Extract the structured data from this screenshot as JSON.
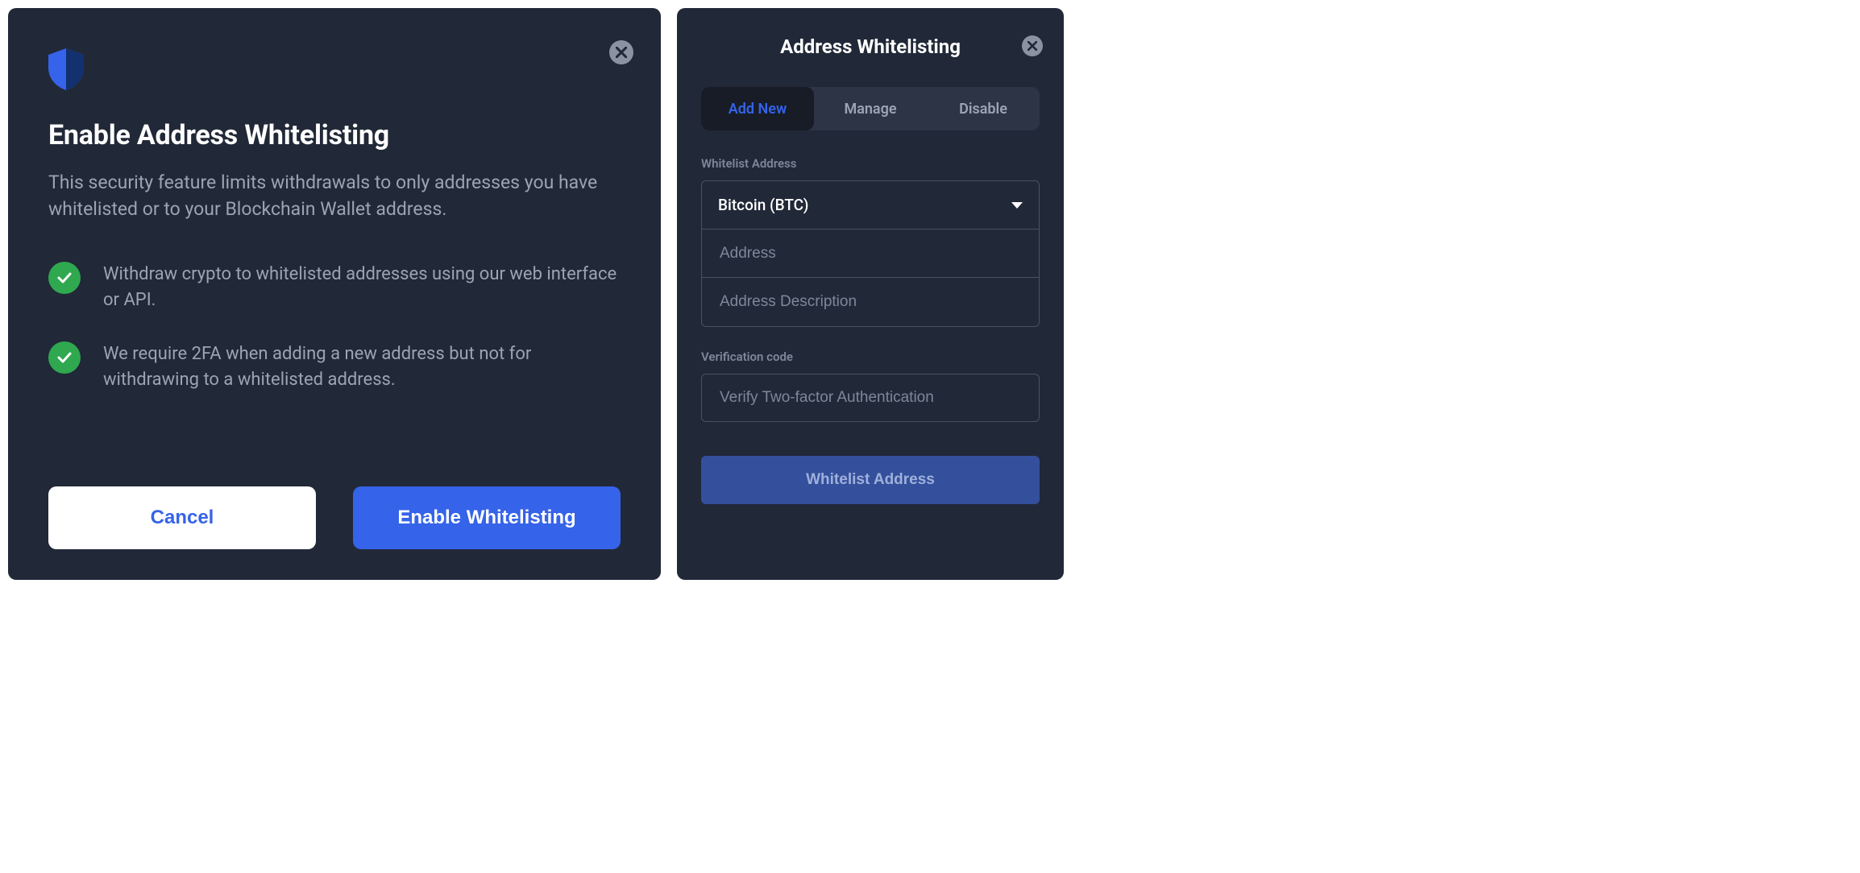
{
  "modal_enable": {
    "title": "Enable Address Whitelisting",
    "description": "This security feature limits withdrawals to only addresses you have whitelisted or to your Blockchain Wallet address.",
    "bullets": [
      "Withdraw crypto to whitelisted addresses using our web interface or API.",
      "We require 2FA when adding a new address but not for withdrawing to a whitelisted address."
    ],
    "cancel_label": "Cancel",
    "confirm_label": "Enable Whitelisting"
  },
  "modal_panel": {
    "title": "Address Whitelisting",
    "tabs": {
      "add_new": "Add New",
      "manage": "Manage",
      "disable": "Disable"
    },
    "whitelist_section_label": "Whitelist Address",
    "currency_selected": "Bitcoin (BTC)",
    "address_placeholder": "Address",
    "address_desc_placeholder": "Address Description",
    "verification_label": "Verification code",
    "verification_placeholder": "Verify Two-factor Authentication",
    "submit_label": "Whitelist Address"
  }
}
